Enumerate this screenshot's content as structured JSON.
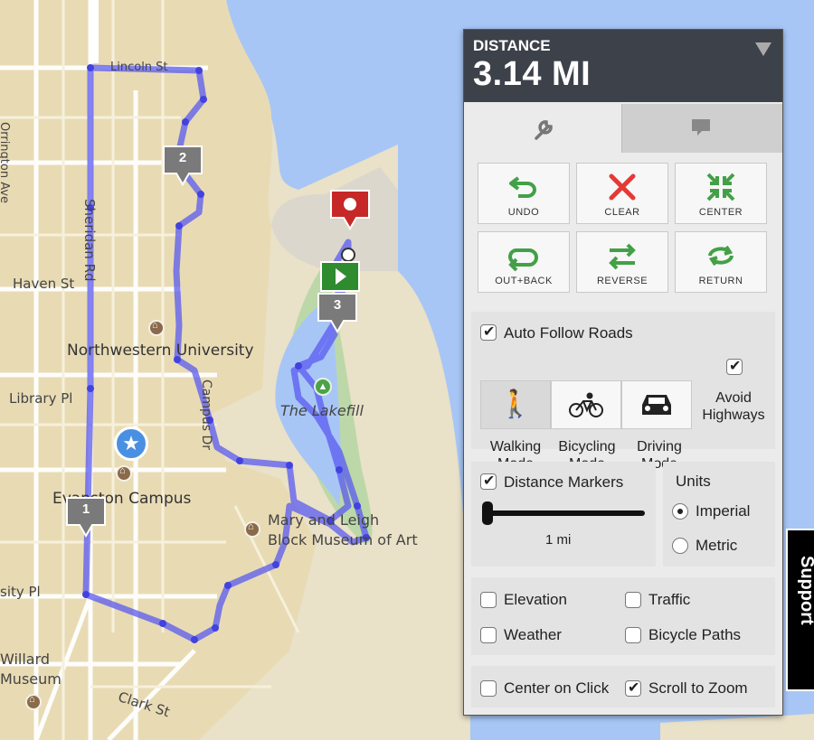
{
  "map": {
    "streets": [
      {
        "name": "Lincoln St",
        "id": "street-lincoln"
      },
      {
        "name": "Sheridan Rd",
        "id": "street-sheridan"
      },
      {
        "name": "Haven St",
        "id": "street-haven"
      },
      {
        "name": "Library Pl",
        "id": "street-library"
      },
      {
        "name": "Campus Dr",
        "id": "street-campus"
      },
      {
        "name": "Clark St",
        "id": "street-clark"
      },
      {
        "name": "sity Pl",
        "id": "street-university"
      },
      {
        "name": "Orrington Ave",
        "id": "street-orrington"
      }
    ],
    "places": {
      "northwestern": "Northwestern University",
      "lakefill": "The Lakefill",
      "evanston": "Evanston Campus",
      "block": "Mary and Leigh Block Museum of Art",
      "block_line1": "Mary and Leigh",
      "block_line2": "Block Museum of Art",
      "willard1": "Willard",
      "willard2": "Museum"
    },
    "markers": [
      "1",
      "2",
      "3"
    ],
    "route_color": "#5a5af0"
  },
  "panel": {
    "distance_label": "DISTANCE",
    "distance_value": "3.14 MI",
    "tabs": {
      "tools_icon": "wrench-icon",
      "feedback_icon": "comment-icon"
    },
    "buttons": {
      "undo": "UNDO",
      "clear": "CLEAR",
      "center": "CENTER",
      "outback": "OUT+BACK",
      "reverse": "REVERSE",
      "return": "RETURN"
    },
    "auto_follow": {
      "label": "Auto Follow Roads",
      "checked": true
    },
    "modes": {
      "walking": "Walking Mode",
      "walking1": "Walking",
      "walking2": "Mode",
      "bicycling1": "Bicycling",
      "bicycling2": "Mode",
      "driving1": "Driving",
      "driving2": "Mode",
      "avoid1": "Avoid",
      "avoid2": "Highways",
      "avoid_checked": true
    },
    "distance_markers": {
      "label": "Distance Markers",
      "checked": true,
      "value": "1 mi"
    },
    "units": {
      "title": "Units",
      "imperial": "Imperial",
      "metric": "Metric",
      "selected": "Imperial"
    },
    "layers": {
      "elevation": "Elevation",
      "traffic": "Traffic",
      "weather": "Weather",
      "bicycle_paths": "Bicycle Paths"
    },
    "options": {
      "center_on_click": "Center on Click",
      "scroll_to_zoom": "Scroll to Zoom",
      "scroll_checked": true
    },
    "support": "Support"
  }
}
